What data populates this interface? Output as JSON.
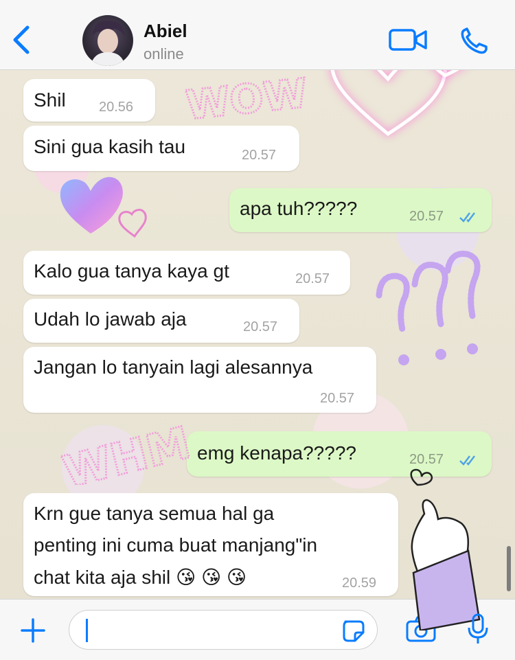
{
  "header": {
    "contact_name": "Abiel",
    "status": "online"
  },
  "messages": [
    {
      "direction": "in",
      "text": "Shil",
      "time": "20.56"
    },
    {
      "direction": "in",
      "text": "Sini gua kasih tau",
      "time": "20.57"
    },
    {
      "direction": "out",
      "text": "apa tuh?????",
      "time": "20.57"
    },
    {
      "direction": "in",
      "text": "Kalo gua tanya kaya gt",
      "time": "20.57"
    },
    {
      "direction": "in",
      "text": "Udah lo jawab aja",
      "time": "20.57"
    },
    {
      "direction": "in",
      "text": "Jangan lo tanyain lagi alesannya",
      "time": "20.57"
    },
    {
      "direction": "out",
      "text": "emg kenapa?????",
      "time": "20.57"
    },
    {
      "direction": "in",
      "lines": [
        "Krn gue tanya semua hal ga",
        "penting ini cuma buat manjang\"in",
        "chat kita aja shil 😘 😘 😘"
      ],
      "time": "20.59"
    }
  ],
  "stickers": {
    "wow": "WOW",
    "whm": "WHM"
  },
  "colors": {
    "accent": "#0a7cff",
    "bubble_in": "#ffffff",
    "bubble_out": "#dcf8c6",
    "sticker_pink": "#f08fd6",
    "sticker_purple": "#c7a8f0"
  },
  "icons": [
    "back-chevron-icon",
    "video-call-icon",
    "phone-icon",
    "plus-icon",
    "sticker-icon",
    "camera-icon",
    "microphone-icon"
  ]
}
